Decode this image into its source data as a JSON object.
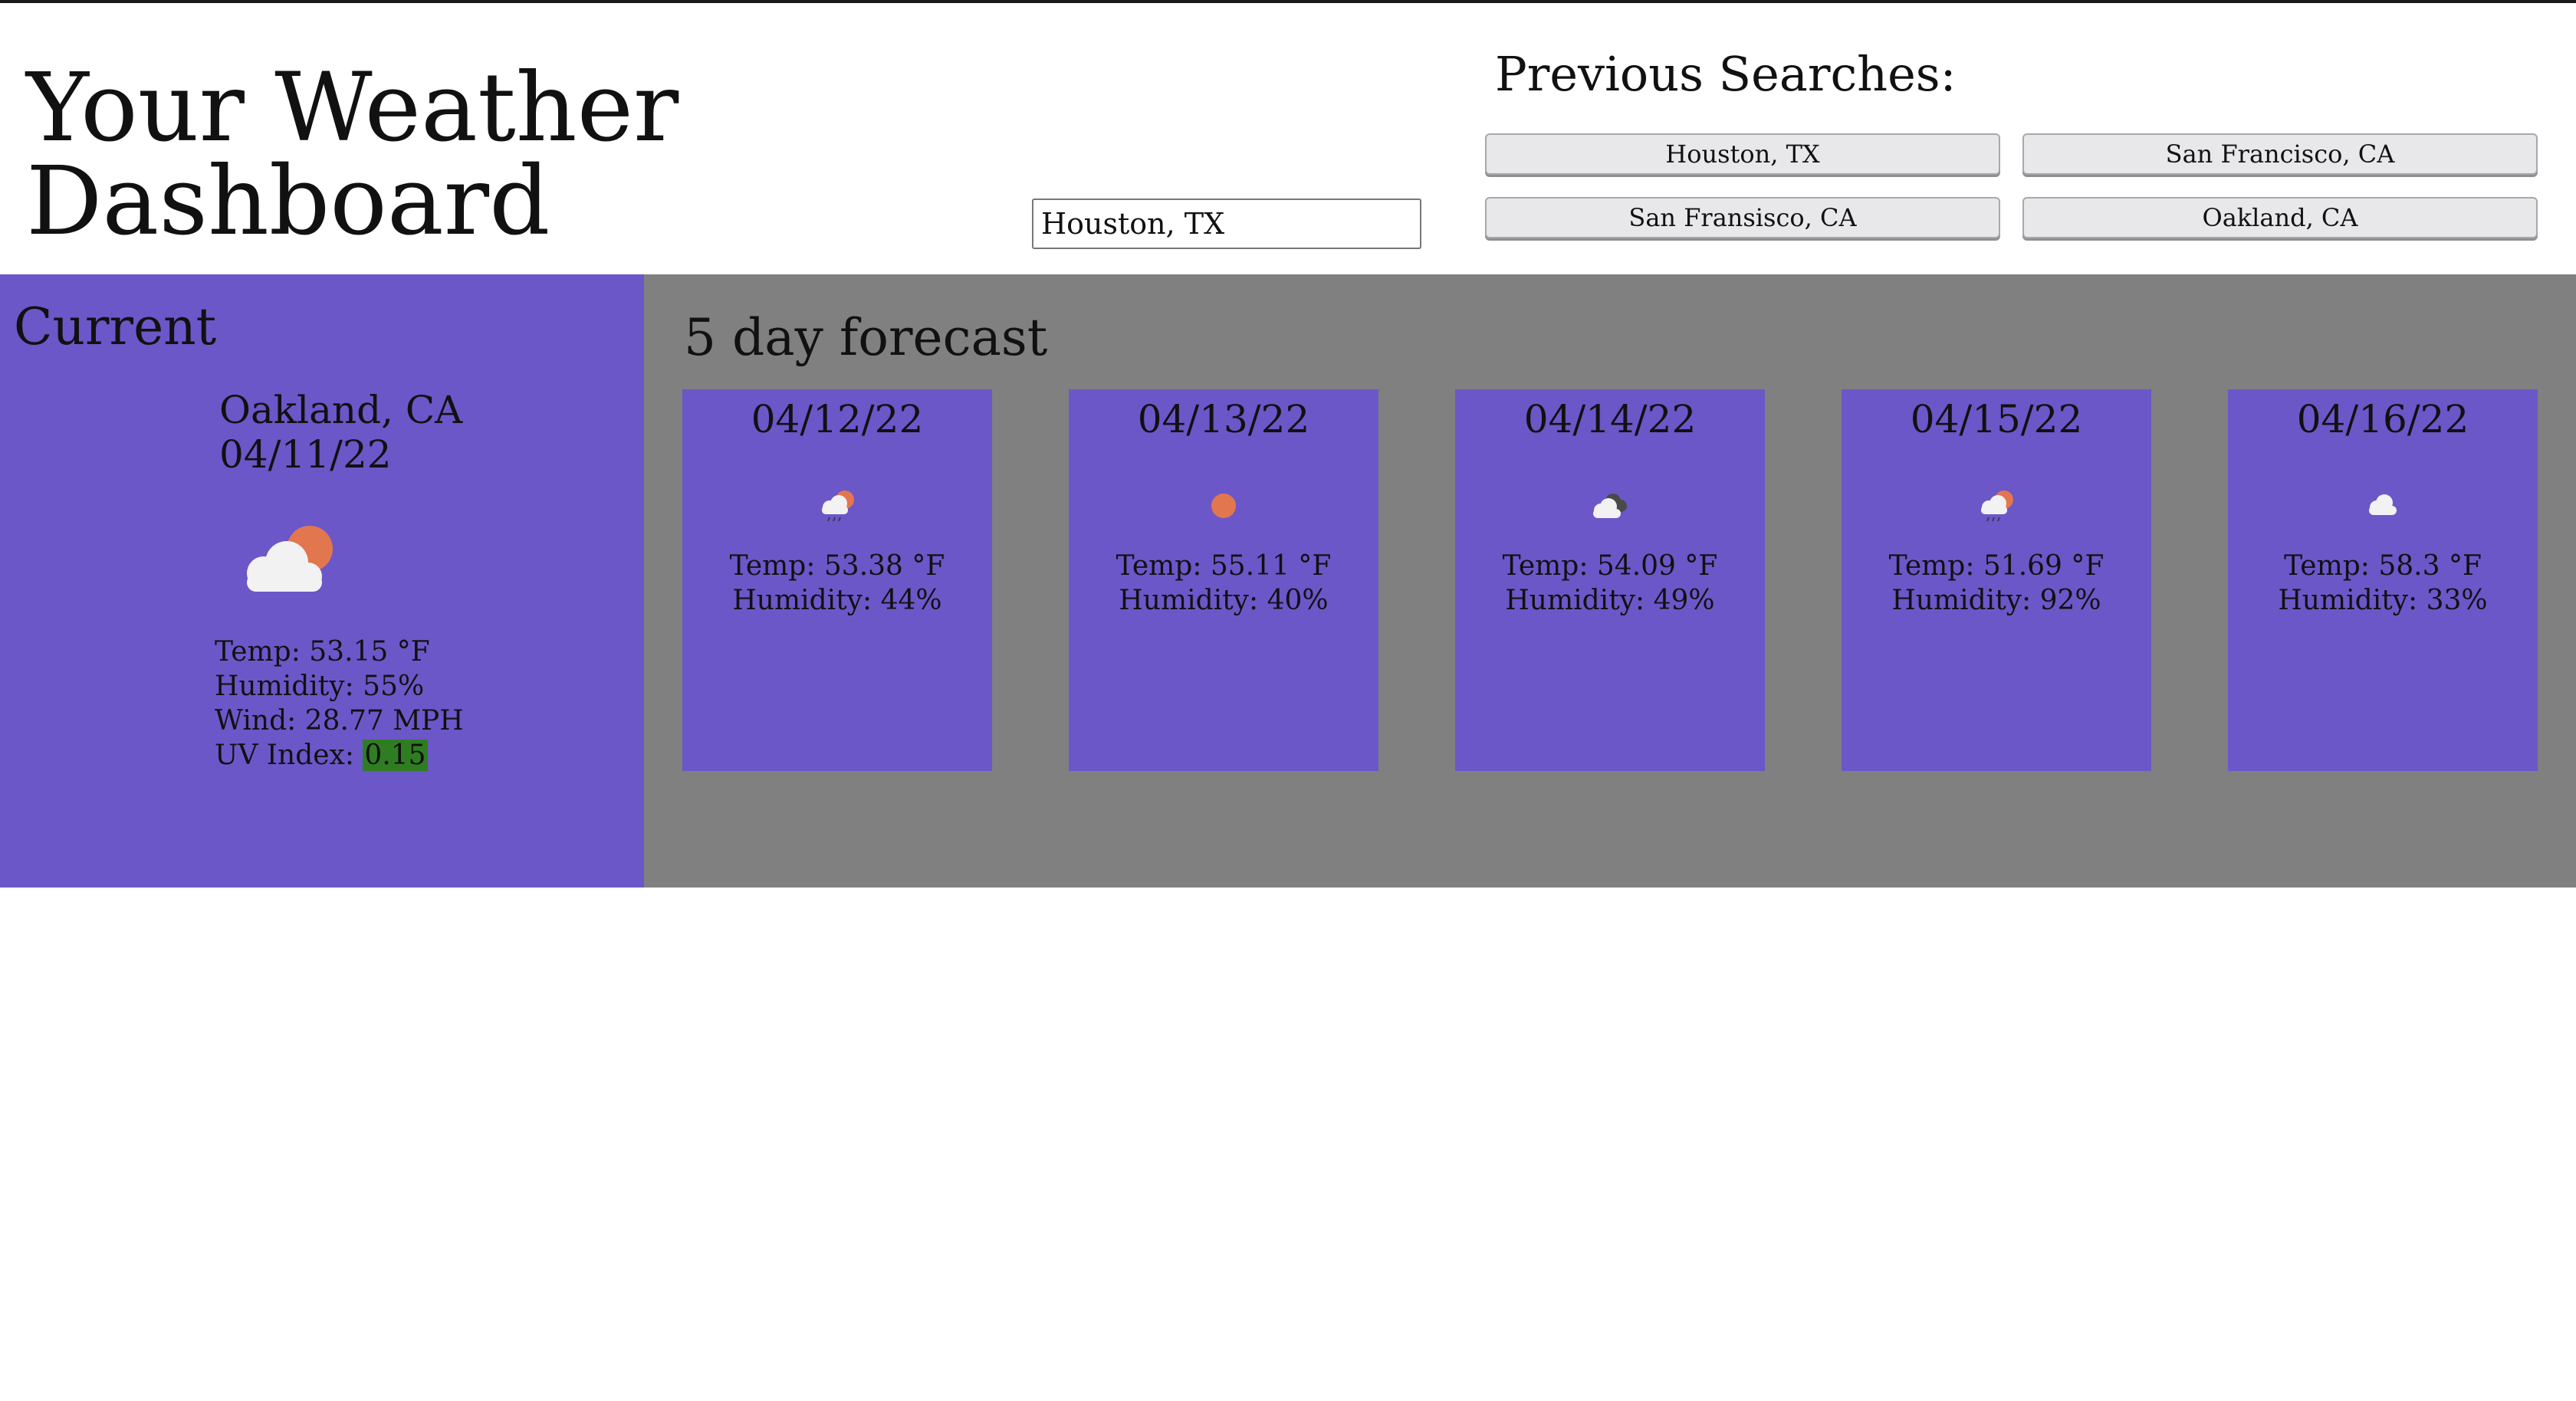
{
  "header": {
    "title_line1": "Your Weather",
    "title_line2": "Dashboard"
  },
  "search": {
    "value": "Houston, TX"
  },
  "previous": {
    "title": "Previous Searches:",
    "items": [
      "Houston, TX",
      "San Francisco, CA",
      "San Fransisco, CA",
      "Oakland, CA"
    ]
  },
  "current": {
    "heading": "Current",
    "city": "Oakland, CA",
    "date": "04/11/22",
    "icon": "partly-cloudy-day-icon",
    "temp": "Temp: 53.15 °F",
    "humidity": "Humidity: 55%",
    "wind": "Wind: 28.77 MPH",
    "uv_label": "UV Index: ",
    "uv_value": "0.15",
    "uv_color": "#2f7d22"
  },
  "forecast": {
    "heading": "5 day forecast",
    "days": [
      {
        "date": "04/12/22",
        "icon": "rain-sun-icon",
        "temp": "Temp: 53.38 °F",
        "humidity": "Humidity: 44%"
      },
      {
        "date": "04/13/22",
        "icon": "sun-icon",
        "temp": "Temp: 55.11 °F",
        "humidity": "Humidity: 40%"
      },
      {
        "date": "04/14/22",
        "icon": "broken-clouds-icon",
        "temp": "Temp: 54.09 °F",
        "humidity": "Humidity: 49%"
      },
      {
        "date": "04/15/22",
        "icon": "rain-sun-icon",
        "temp": "Temp: 51.69 °F",
        "humidity": "Humidity: 92%"
      },
      {
        "date": "04/16/22",
        "icon": "cloud-icon",
        "temp": "Temp: 58.3 °F",
        "humidity": "Humidity: 33%"
      }
    ]
  },
  "colors": {
    "panel": "#6b57c8",
    "forecast_bg": "#808080",
    "sun": "#e2774f",
    "cloud": "#f2f2f2"
  }
}
